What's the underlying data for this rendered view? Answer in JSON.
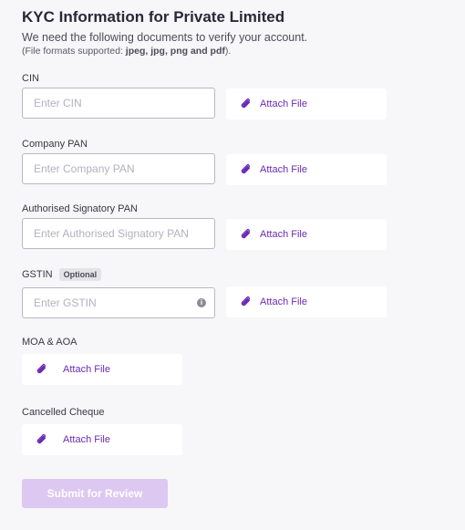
{
  "header": {
    "title": "KYC Information for Private Limited",
    "subtitle": "We need the following documents to verify your account.",
    "formats_prefix": "(File formats supported: ",
    "formats_bold": "jpeg, jpg, png and pdf",
    "formats_suffix": ")."
  },
  "fields": {
    "cin": {
      "label": "CIN",
      "placeholder": "Enter CIN",
      "value": "",
      "attach_label": "Attach File"
    },
    "company_pan": {
      "label": "Company PAN",
      "placeholder": "Enter Company PAN",
      "value": "",
      "attach_label": "Attach File"
    },
    "signatory_pan": {
      "label": "Authorised Signatory PAN",
      "placeholder": "Enter Authorised Signatory PAN",
      "value": "",
      "attach_label": "Attach File"
    },
    "gstin": {
      "label": "GSTIN",
      "badge": "Optional",
      "placeholder": "Enter GSTIN",
      "value": "",
      "info_icon": "info-icon",
      "attach_label": "Attach File"
    },
    "moa_aoa": {
      "label": "MOA & AOA",
      "attach_label": "Attach File"
    },
    "cancelled_cheque": {
      "label": "Cancelled Cheque",
      "attach_label": "Attach File"
    }
  },
  "submit": {
    "label": "Submit for Review",
    "disabled": true
  },
  "icons": {
    "attach": "paperclip-icon"
  },
  "colors": {
    "accent": "#6a2bb5",
    "submit_disabled": "#dcc8f1",
    "background": "#f7f6f8"
  }
}
